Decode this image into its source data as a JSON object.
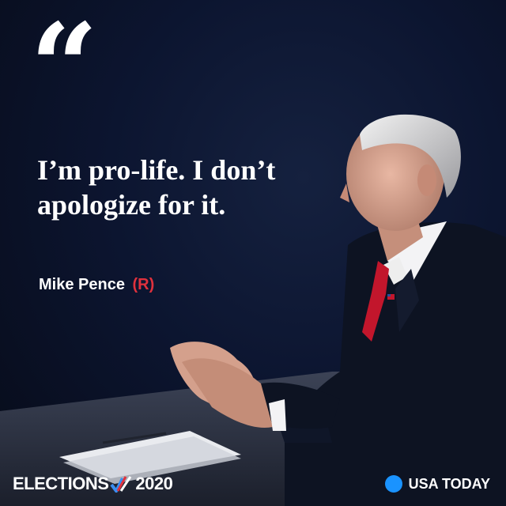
{
  "quote": {
    "mark": "“",
    "text": "I’m pro-life. I don’t apologize for it."
  },
  "speaker": {
    "name": "Mike Pence",
    "party": "(R)"
  },
  "footer": {
    "left_prefix": "ELECTIONS",
    "left_year": "2020",
    "right_brand": "USA TODAY"
  },
  "colors": {
    "background": "#0b1020",
    "party_red": "#e0313d",
    "brand_blue": "#1a93ff",
    "check_blue": "#3a8df0",
    "check_red": "#e0313d"
  },
  "icons": {
    "elections_check": "checkmark-icon",
    "brand_dot": "usa-today-dot-icon"
  }
}
